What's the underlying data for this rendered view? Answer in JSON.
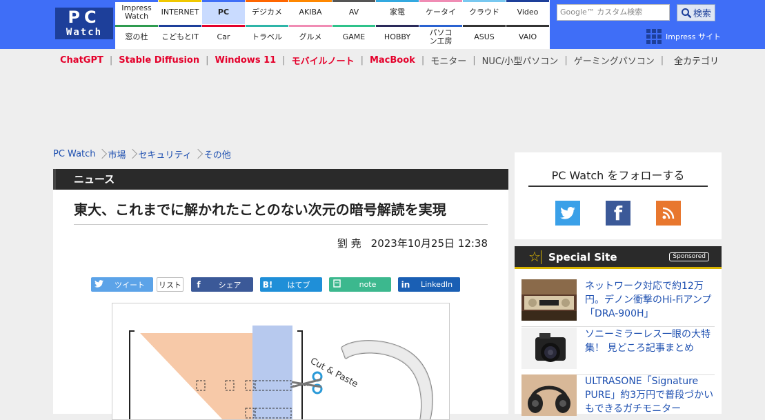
{
  "logo": {
    "line1": "PC",
    "line2": "Watch"
  },
  "nav": {
    "row1": [
      {
        "label": "Impress Watch",
        "color": "#3f6ef7"
      },
      {
        "label": "INTERNET",
        "color": "#f0c800"
      },
      {
        "label": "PC",
        "color": "#3f6ef7",
        "active": true
      },
      {
        "label": "デジカメ",
        "color": "#ff6600"
      },
      {
        "label": "AKIBA",
        "color": "#ff8800"
      },
      {
        "label": "AV",
        "color": "#555555"
      },
      {
        "label": "家電",
        "color": "#33a9e0"
      },
      {
        "label": "ケータイ",
        "color": "#f08cb4"
      },
      {
        "label": "クラウド",
        "color": "#78c8f0"
      },
      {
        "label": "Video",
        "color": "#1d3f9a"
      }
    ],
    "row2": [
      {
        "label": "窓の杜",
        "color": "#2e9b4f"
      },
      {
        "label": "こどもとIT",
        "color": "#1d3f9a"
      },
      {
        "label": "Car",
        "color": "#e4002b"
      },
      {
        "label": "トラベル",
        "color": "#2eb5a8"
      },
      {
        "label": "グルメ",
        "color": "#f08cb4"
      },
      {
        "label": "GAME",
        "color": "#2ec28a"
      },
      {
        "label": "HOBBY",
        "color": "#2a2a5a"
      },
      {
        "label": "パソコン工房",
        "color": "#2a62d0"
      },
      {
        "label": "ASUS",
        "color": "#333333"
      },
      {
        "label": "VAIO",
        "color": "#333333"
      }
    ]
  },
  "search": {
    "placeholder": "Google™ カスタム検索",
    "button_label": "検索"
  },
  "impress_site": "Impress サイト",
  "topics": [
    {
      "label": "ChatGPT",
      "hot": true
    },
    {
      "label": "Stable Diffusion",
      "hot": true
    },
    {
      "label": "Windows 11",
      "hot": true
    },
    {
      "label": "モバイルノート",
      "hot": true
    },
    {
      "label": "MacBook",
      "hot": true
    },
    {
      "label": "モニター",
      "hot": false
    },
    {
      "label": "NUC/小型パソコン",
      "hot": false
    },
    {
      "label": "ゲーミングパソコン",
      "hot": false
    }
  ],
  "all_categories": "全カテゴリ",
  "breadcrumb": [
    "PC Watch",
    "市場",
    "セキュリティ",
    "その他"
  ],
  "article": {
    "section": "ニュース",
    "headline": "東大、これまでに解かれたことのない次元の暗号解読を実現",
    "author": "劉 尭",
    "date": "2023年10月25日 12:38",
    "figure_text": "Cut & Paste"
  },
  "share": {
    "tweet": "ツイート",
    "list": "リスト",
    "facebook": "シェア",
    "hatena": "はてブ",
    "note": "note",
    "linkedin": "LinkedIn"
  },
  "follow": {
    "title": "PC Watch をフォローする"
  },
  "special": {
    "title": "Special Site",
    "sponsored": "Sponsored",
    "items": [
      "ネットワーク対応で約12万円。デノン衝撃のHi-Fiアンプ「DRA-900H」",
      "ソニーミラーレス一眼の大特集！ 見どころ記事まとめ",
      "ULTRASONE「Signature PURE」約3万円で普段づかいもできるガチモニター"
    ]
  },
  "colors": {
    "brand": "#3f6ef7",
    "logo_bg": "#1d3f9a",
    "hot_topic": "#e4002b",
    "link": "#1d4fb0"
  }
}
